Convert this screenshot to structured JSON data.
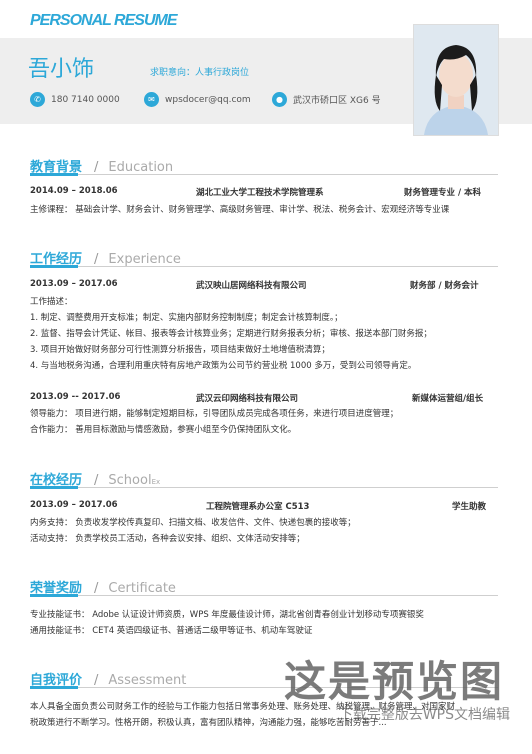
{
  "banner": "PERSONAL RESUME",
  "header": {
    "name": "吾小饰",
    "objective": "求职意向：人事行政岗位",
    "phone": "180 7140 0000",
    "email": "wpsdocer@qq.com",
    "address": "武汉市硚口区 XG6 号"
  },
  "education": {
    "title": "教育背景",
    "title_en": "Education",
    "period": "2014.09 – 2018.06",
    "school": "湖北工业大学工程技术学院管理系",
    "major": "财务管理专业 / 本科",
    "courses": "主修课程：  基础会计学、财务会计、财务管理学、高级财务管理、审计学、税法、税务会计、宏观经济等专业课"
  },
  "experience": {
    "title": "工作经历",
    "title_en": "Experience",
    "job1": {
      "period": "2013.09 – 2017.06",
      "company": "武汉映山居网络科技有限公司",
      "role": "财务部 / 财务会计",
      "desc_label": "工作描述：",
      "items": [
        "1.  制定、调整费用开支标准；制定、实施内部财务控制制度；制定会计核算制度。；",
        "2.  监督、指导会计凭证、帐目、报表等会计核算业务；定期进行财务报表分析；审核、报送本部门财务报；",
        "3.  项目开始做好财务部分可行性测算分析报告，项目结束做好土地增值税清算；",
        "4.  与当地税务沟通，合理利用重庆特有房地产政策为公司节约营业税 1000 多万，受到公司领导肯定。"
      ]
    },
    "job2": {
      "period": "2013.09 -- 2017.06",
      "company": "武汉云印网络科技有限公司",
      "role": "新媒体运营组/组长",
      "lines": [
        "领导能力：    项目进行期，能够制定短期目标，引导团队成员完成各项任务，来进行项目进度管理；",
        "合作能力：    善用目标激励与情感激励，参赛小组至今仍保持团队文化。"
      ]
    }
  },
  "school": {
    "title": "在校经历",
    "title_en": "School",
    "title_suffix": "Ex",
    "period": "2013.09 – 2017.06",
    "org": "工程院管理系办公室 C513",
    "role": "学生助教",
    "lines": [
      "内务支持：    负责收发学校传真复印、扫描文档、收发信件、文件、快递包裹的接收等；",
      "活动支持：    负责学校员工活动，各种会议安排、组织、文体活动安排等；"
    ]
  },
  "certificate": {
    "title": "荣誉奖励",
    "title_en": "Certificate",
    "lines": [
      "专业技能证书：    Adobe 认证设计师资质，WPS 年度最佳设计师，湖北省创青春创业计划移动专项赛银奖",
      "通用技能证书：    CET4  英语四级证书、普通话二级甲等证书、机动车驾驶证"
    ]
  },
  "assessment": {
    "title": "自我评价",
    "title_en": "Assessment",
    "lines": [
      "本人具备全面负责公司财务工作的经验与工作能力包括日常事务处理、账务处理、纳税管理、财务管理、对国家财",
      "税政策进行不断学习。性格开朗，积极认真，富有团队精神，沟通能力强，能够吃苦耐劳善于..."
    ]
  },
  "watermark": {
    "big": "这是预览图",
    "small": "下载完整版去WPS文档编辑"
  }
}
